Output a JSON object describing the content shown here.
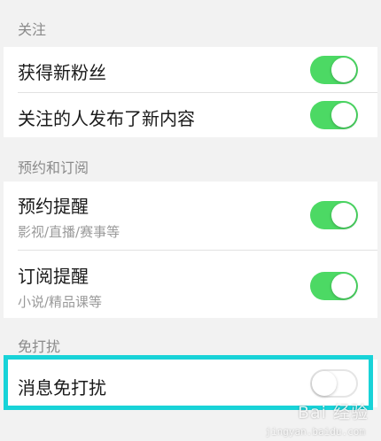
{
  "sections": [
    {
      "header": "关注",
      "rows": [
        {
          "title": "获得新粉丝",
          "subtitle": "",
          "toggle": "on"
        },
        {
          "title": "关注的人发布了新内容",
          "subtitle": "",
          "toggle": "on"
        }
      ]
    },
    {
      "header": "预约和订阅",
      "rows": [
        {
          "title": "预约提醒",
          "subtitle": "影视/直播/赛事等",
          "toggle": "on"
        },
        {
          "title": "订阅提醒",
          "subtitle": "小说/精品课等",
          "toggle": "on"
        }
      ]
    },
    {
      "header": "免打扰",
      "rows": [
        {
          "title": "消息免打扰",
          "subtitle": "",
          "toggle": "off"
        }
      ]
    }
  ],
  "colors": {
    "toggle_on": "#4cd964",
    "highlight_border": "#18d3d8",
    "background": "#f2f2f2"
  },
  "watermark": {
    "text": "Bai 经验",
    "sub": "jingyan.baidu.com"
  }
}
